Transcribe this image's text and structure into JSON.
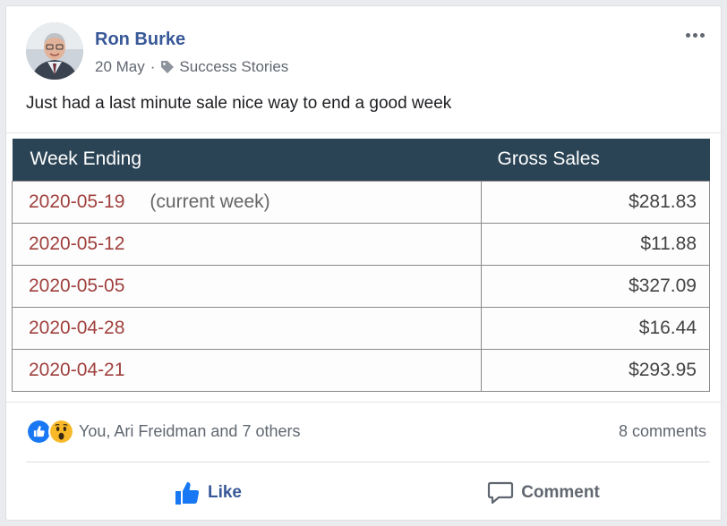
{
  "post": {
    "author": "Ron Burke",
    "date": "20 May",
    "separator": "·",
    "category": "Success Stories",
    "text": "Just had a last minute sale nice way to end a good week"
  },
  "table": {
    "headers": [
      "Week Ending",
      "Gross Sales"
    ],
    "rows": [
      {
        "date": "2020-05-19",
        "note": "(current week)",
        "amount": "$281.83"
      },
      {
        "date": "2020-05-12",
        "note": "",
        "amount": "$11.88"
      },
      {
        "date": "2020-05-05",
        "note": "",
        "amount": "$327.09"
      },
      {
        "date": "2020-04-28",
        "note": "",
        "amount": "$16.44"
      },
      {
        "date": "2020-04-21",
        "note": "",
        "amount": "$293.95"
      }
    ]
  },
  "reactions": {
    "text": "You, Ari Freidman and 7 others",
    "icons": [
      "like-reaction-icon",
      "wow-reaction-icon"
    ],
    "comments": "8 comments"
  },
  "actions": {
    "like": "Like",
    "comment": "Comment"
  },
  "colors": {
    "author": "#385898",
    "table_header": "#2b4455",
    "date_text": "#a0413e",
    "like_blue": "#1877f2"
  }
}
